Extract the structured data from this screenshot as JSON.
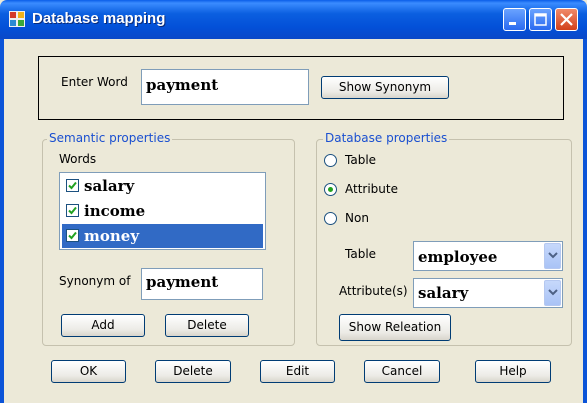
{
  "window": {
    "title": "Database mapping",
    "icon": "app-grid-icon",
    "controls": [
      "minimize-icon",
      "maximize-icon",
      "close-icon"
    ]
  },
  "word_entry": {
    "label": "Enter Word",
    "value": "payment",
    "show_synonym_label": "Show Synonym"
  },
  "semantic": {
    "legend": "Semantic properties",
    "words_label": "Words",
    "words": [
      {
        "text": "salary",
        "checked": true,
        "selected": false
      },
      {
        "text": "income",
        "checked": true,
        "selected": false
      },
      {
        "text": "money",
        "checked": true,
        "selected": true
      }
    ],
    "synonym_label": "Synonym of",
    "synonym_value": "payment",
    "add_label": "Add",
    "delete_label": "Delete"
  },
  "database": {
    "legend": "Database properties",
    "options": [
      {
        "label": "Table",
        "selected": false
      },
      {
        "label": "Attribute",
        "selected": true
      },
      {
        "label": "Non",
        "selected": false
      }
    ],
    "table_label": "Table",
    "table_value": "employee",
    "attribute_label": "Attribute(s)",
    "attribute_value": "salary",
    "show_relation_label": "Show Releation"
  },
  "footer": {
    "ok": "OK",
    "delete": "Delete",
    "edit": "Edit",
    "cancel": "Cancel",
    "help": "Help"
  },
  "colors": {
    "titlebar": "#0350d8",
    "selection": "#316ac5",
    "legend_text": "#1a4fd0",
    "window_bg": "#ece9d8"
  }
}
